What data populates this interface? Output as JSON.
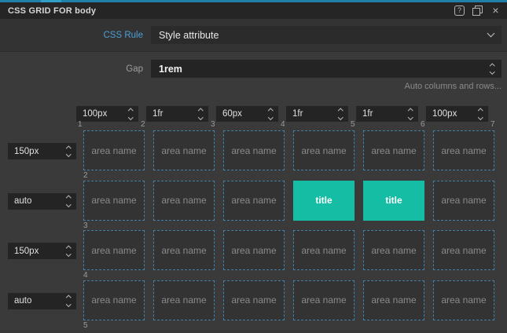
{
  "titlebar": {
    "title": "CSS GRID FOR body",
    "help_icon": "question-mark",
    "help_glyph": "?",
    "restore_icon": "overlapping-windows",
    "close_icon": "x",
    "close_glyph": "×"
  },
  "rule_row": {
    "label": "CSS Rule",
    "value": "Style attribute"
  },
  "gap_row": {
    "label": "Gap",
    "value": "1rem"
  },
  "hint": "Auto columns and rows...",
  "grid": {
    "column_tracks": [
      "100px",
      "1fr",
      "60px",
      "1fr",
      "1fr",
      "100px"
    ],
    "row_tracks": [
      "150px",
      "auto",
      "150px",
      "auto"
    ],
    "top_line_numbers": [
      "1",
      "2",
      "3",
      "4",
      "5",
      "6",
      "7"
    ],
    "left_line_numbers": [
      "2",
      "3",
      "4",
      "5"
    ],
    "cells": [
      [
        {
          "label": "area name",
          "variant": "area"
        },
        {
          "label": "area name",
          "variant": "area"
        },
        {
          "label": "area name",
          "variant": "area"
        },
        {
          "label": "area name",
          "variant": "area"
        },
        {
          "label": "area name",
          "variant": "area"
        },
        {
          "label": "area name",
          "variant": "area"
        }
      ],
      [
        {
          "label": "area name",
          "variant": "area"
        },
        {
          "label": "area name",
          "variant": "area"
        },
        {
          "label": "area name",
          "variant": "area"
        },
        {
          "label": "title",
          "variant": "title"
        },
        {
          "label": "title",
          "variant": "title"
        },
        {
          "label": "area name",
          "variant": "area"
        }
      ],
      [
        {
          "label": "area name",
          "variant": "area"
        },
        {
          "label": "area name",
          "variant": "area"
        },
        {
          "label": "area name",
          "variant": "area"
        },
        {
          "label": "area name",
          "variant": "area"
        },
        {
          "label": "area name",
          "variant": "area"
        },
        {
          "label": "area name",
          "variant": "area"
        }
      ],
      [
        {
          "label": "area name",
          "variant": "area"
        },
        {
          "label": "area name",
          "variant": "area"
        },
        {
          "label": "area name",
          "variant": "area"
        },
        {
          "label": "area name",
          "variant": "area"
        },
        {
          "label": "area name",
          "variant": "area"
        },
        {
          "label": "area name",
          "variant": "area"
        }
      ]
    ],
    "colors": {
      "accent_top": "#1f81a9",
      "grid_line_blue": "#4382a8",
      "title_cell_teal": "#15bda4",
      "label_blue": "#4aa0d5"
    }
  }
}
